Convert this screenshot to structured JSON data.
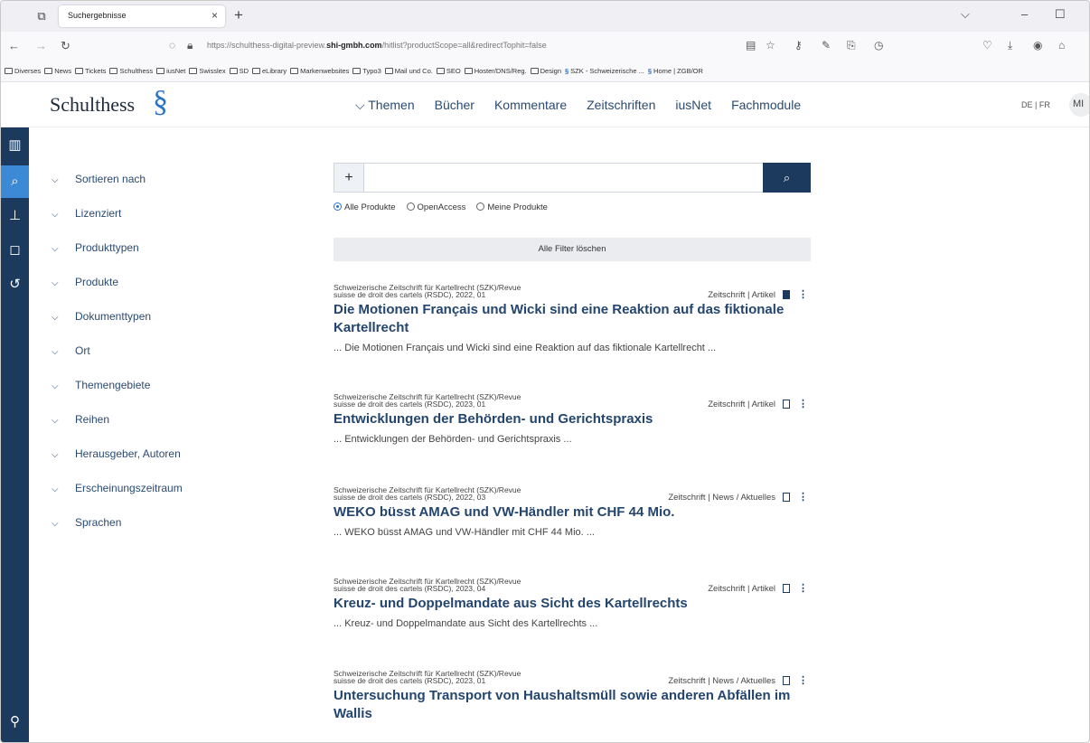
{
  "browser": {
    "tab_title": "Suchergebnisse",
    "url_prefix": "https://schulthess-digital-preview.",
    "url_domain": "shi-gmbh.com",
    "url_path": "/hitlist?productScope=all&redirectTophit=false",
    "bookmarks": [
      {
        "label": "Diverses",
        "type": "folder"
      },
      {
        "label": "News",
        "type": "folder"
      },
      {
        "label": "Tickets",
        "type": "folder"
      },
      {
        "label": "Schulthess",
        "type": "folder"
      },
      {
        "label": "iusNet",
        "type": "folder"
      },
      {
        "label": "Swisslex",
        "type": "folder"
      },
      {
        "label": "SD",
        "type": "folder"
      },
      {
        "label": "eLibrary",
        "type": "folder"
      },
      {
        "label": "Markenwebsites",
        "type": "folder"
      },
      {
        "label": "Typo3",
        "type": "folder"
      },
      {
        "label": "Mail und Co.",
        "type": "folder"
      },
      {
        "label": "SEO",
        "type": "folder"
      },
      {
        "label": "Hoster/DNS/Reg.",
        "type": "folder"
      },
      {
        "label": "Design",
        "type": "folder"
      },
      {
        "label": "SZK - Schweizerische ...",
        "type": "site"
      },
      {
        "label": "Home | ZGB/OR",
        "type": "site"
      }
    ]
  },
  "header": {
    "logo_text": "Schulthess",
    "logo_mark": "§",
    "nav": [
      "⌵ Themen",
      "Bücher",
      "Kommentare",
      "Zeitschriften",
      "iusNet",
      "Fachmodule"
    ],
    "lang": "DE | FR",
    "avatar": "MI"
  },
  "filters": [
    "Sortieren nach",
    "Lizenziert",
    "Produkttypen",
    "Produkte",
    "Dokumenttypen",
    "Ort",
    "Themengebiete",
    "Reihen",
    "Herausgeber, Autoren",
    "Erscheinungszeitraum",
    "Sprachen"
  ],
  "search": {
    "plus": "+",
    "placeholder": "",
    "radios": [
      {
        "label": "Alle Produkte",
        "selected": true
      },
      {
        "label": "OpenAccess",
        "selected": false
      },
      {
        "label": "Meine Produkte",
        "selected": false
      }
    ],
    "clear_label": "Alle Filter löschen"
  },
  "results": [
    {
      "source_1": "Schweizerische Zeitschrift für Kartellrecht (SZK)/Revue",
      "source_2": "suisse de droit des cartels (RSDC), 2022, 01",
      "meta": "Zeitschrift | Artikel",
      "bookmarked": true,
      "title": "Die Motionen Français und Wicki sind eine Reaktion auf das fiktionale Kartellrecht",
      "snippet": "... Die Motionen Français und Wicki sind eine Reaktion auf das fiktionale Kartellrecht ..."
    },
    {
      "source_1": "Schweizerische Zeitschrift für Kartellrecht (SZK)/Revue",
      "source_2": "suisse de droit des cartels (RSDC), 2023, 01",
      "meta": "Zeitschrift | Artikel",
      "bookmarked": false,
      "title": "Entwicklungen der Behörden- und Gerichtspraxis",
      "snippet": "... Entwicklungen der Behörden- und Gerichtspraxis ..."
    },
    {
      "source_1": "Schweizerische Zeitschrift für Kartellrecht (SZK)/Revue",
      "source_2": "suisse de droit des cartels (RSDC), 2022, 03",
      "meta": "Zeitschrift | News / Aktuelles",
      "bookmarked": false,
      "title": "WEKO büsst AMAG und VW-Händler mit CHF 44 Mio.",
      "snippet": "... WEKO büsst AMAG und VW-Händler mit CHF 44 Mio. ..."
    },
    {
      "source_1": "Schweizerische Zeitschrift für Kartellrecht (SZK)/Revue",
      "source_2": "suisse de droit des cartels (RSDC), 2023, 04",
      "meta": "Zeitschrift | Artikel",
      "bookmarked": false,
      "title": "Kreuz- und Doppelmandate aus Sicht des Kartellrechts",
      "snippet": "... Kreuz- und Doppelmandate aus Sicht des Kartellrechts ..."
    },
    {
      "source_1": "Schweizerische Zeitschrift für Kartellrecht (SZK)/Revue",
      "source_2": "suisse de droit des cartels (RSDC), 2023, 01",
      "meta": "Zeitschrift | News / Aktuelles",
      "bookmarked": false,
      "title": "Untersuchung Transport von Haushaltsmüll sowie anderen Abfällen im Wallis",
      "snippet": ""
    }
  ],
  "colors": {
    "navy": "#1c3a5e",
    "accent": "#3c8ad6",
    "title": "#24456e"
  }
}
